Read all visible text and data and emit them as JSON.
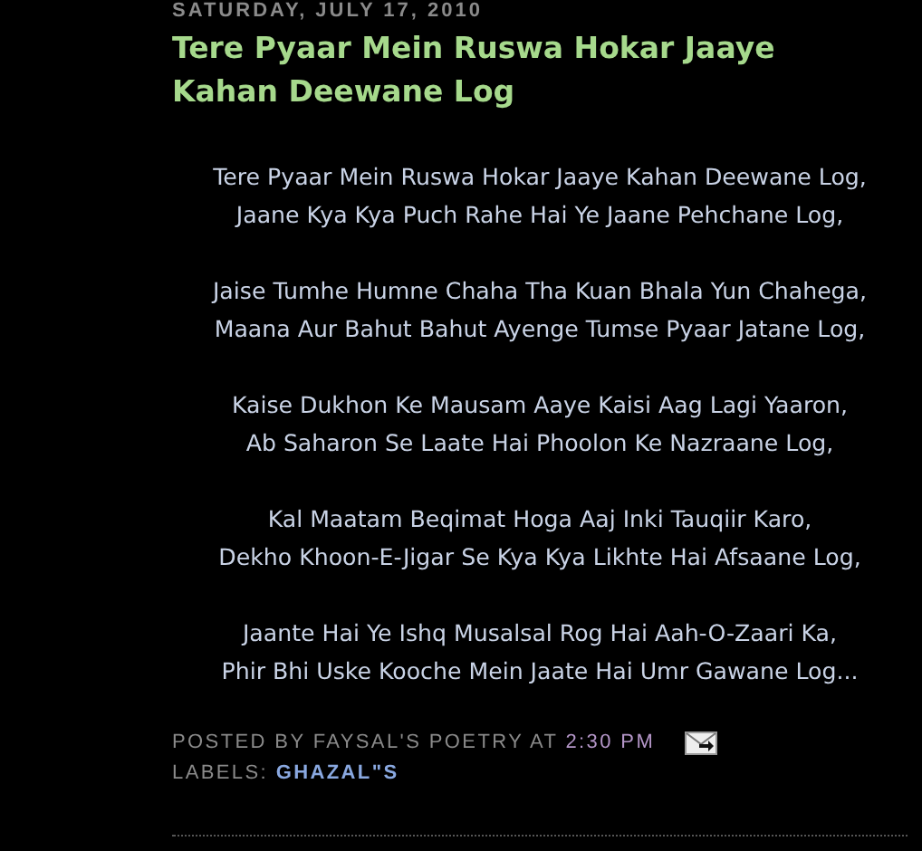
{
  "post": {
    "date": "SATURDAY, JULY 17, 2010",
    "title": "Tere Pyaar Mein Ruswa Hokar Jaaye Kahan Deewane Log",
    "stanzas": [
      [
        "Tere Pyaar Mein Ruswa Hokar Jaaye Kahan Deewane Log,",
        "Jaane Kya Kya Puch Rahe Hai Ye Jaane Pehchane Log,"
      ],
      [
        "Jaise Tumhe Humne Chaha Tha Kuan Bhala Yun Chahega,",
        "Maana Aur Bahut Bahut Ayenge Tumse Pyaar Jatane Log,"
      ],
      [
        "Kaise Dukhon Ke Mausam Aaye Kaisi Aag Lagi Yaaron,",
        "Ab Saharon Se Laate Hai Phoolon Ke Nazraane Log,"
      ],
      [
        "Kal Maatam Beqimat Hoga Aaj Inki Tauqiir Karo,",
        "Dekho Khoon-E-Jigar Se Kya Kya Likhte Hai Afsaane Log,"
      ],
      [
        "Jaante Hai Ye Ishq Musalsal Rog Hai Aah-O-Zaari Ka,",
        "Phir Bhi Uske Kooche Mein Jaate Hai Umr Gawane Log..."
      ]
    ],
    "posted_by": "POSTED BY FAYSAL'S POETRY AT",
    "time": "2:30 PM",
    "labels_prefix": "LABELS:",
    "labels": [
      "GHAZAL\"S"
    ]
  }
}
